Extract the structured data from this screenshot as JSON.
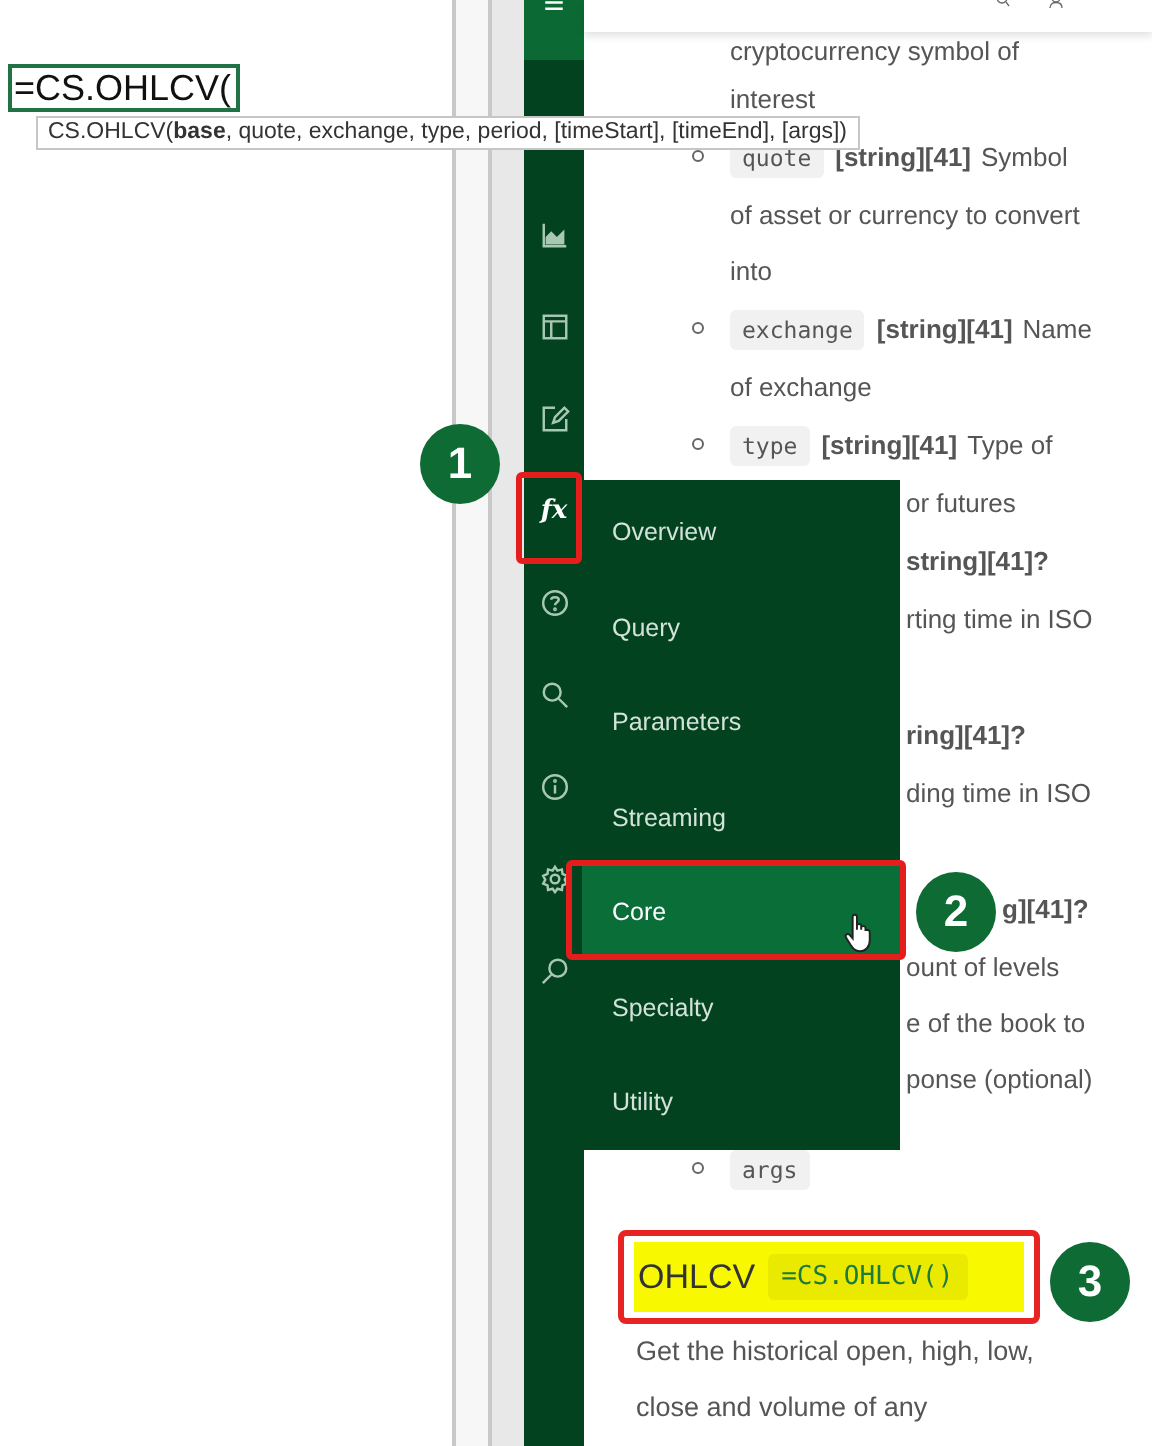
{
  "sheet": {
    "cell_value": "=CS.OHLCV(",
    "tooltip": "CS.OHLCV(**base**, quote, exchange, type, period, [timeStart], [timeEnd], [args])"
  },
  "sidebar": {
    "function_label": "fx"
  },
  "menu": {
    "items": [
      {
        "label": "Overview",
        "selected": false
      },
      {
        "label": "Query",
        "selected": false
      },
      {
        "label": "Parameters",
        "selected": false
      },
      {
        "label": "Streaming",
        "selected": false
      },
      {
        "label": "Core",
        "selected": true
      },
      {
        "label": "Specialty",
        "selected": false
      },
      {
        "label": "Utility",
        "selected": false
      }
    ]
  },
  "doc": {
    "lines": [
      {
        "kind": "text",
        "text": "cryptocurrency symbol of"
      },
      {
        "kind": "text",
        "text": "interest"
      },
      {
        "kind": "param",
        "code": "quote",
        "type": "[string][41]",
        "text": "Symbol"
      },
      {
        "kind": "text",
        "text": "of asset or currency to convert"
      },
      {
        "kind": "text",
        "text": "into"
      },
      {
        "kind": "param",
        "code": "exchange",
        "type": "[string][41]",
        "text": "Name"
      },
      {
        "kind": "text",
        "text": "of exchange"
      },
      {
        "kind": "param",
        "code": "type",
        "type": "[string][41]",
        "text": "Type of"
      },
      {
        "kind": "partial",
        "text": "or futures"
      },
      {
        "kind": "partial-type",
        "text": "string][41]?"
      },
      {
        "kind": "partial",
        "text": "rting time in ISO"
      },
      {
        "kind": "partial-type",
        "text": "ring][41]?"
      },
      {
        "kind": "partial",
        "text": "ding time in ISO"
      },
      {
        "kind": "partial-type",
        "text": "g][41]?"
      },
      {
        "kind": "partial",
        "text": "ount of levels"
      },
      {
        "kind": "partial",
        "text": "e of the book to"
      },
      {
        "kind": "partial",
        "text": "ponse (optional)"
      },
      {
        "kind": "param",
        "code": "args"
      }
    ],
    "heading": {
      "title": "OHLCV",
      "code": "=CS.OHLCV()"
    },
    "paragraph_lines": [
      "Get the historical open, high, low,",
      "close and volume of any"
    ]
  },
  "callouts": [
    {
      "number": "1"
    },
    {
      "number": "2"
    },
    {
      "number": "3"
    }
  ]
}
